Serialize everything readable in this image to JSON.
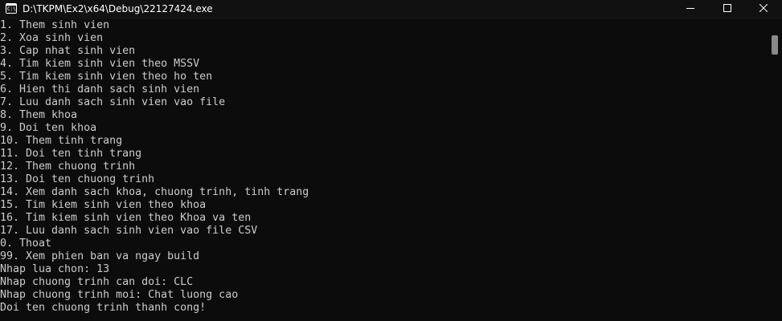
{
  "window": {
    "title": "D:\\TKPM\\Ex2\\x64\\Debug\\22127424.exe",
    "icon": "console-app-icon",
    "icon_text": "C:\\"
  },
  "console": {
    "lines": [
      "1. Them sinh vien",
      "2. Xoa sinh vien",
      "3. Cap nhat sinh vien",
      "4. Tim kiem sinh vien theo MSSV",
      "5. Tim kiem sinh vien theo ho ten",
      "6. Hien thi danh sach sinh vien",
      "7. Luu danh sach sinh vien vao file",
      "8. Them khoa",
      "9. Doi ten khoa",
      "10. Them tinh trang",
      "11. Doi ten tinh trang",
      "12. Them chuong trinh",
      "13. Doi ten chuong trinh",
      "14. Xem danh sach khoa, chuong trinh, tinh trang",
      "15. Tim kiem sinh vien theo khoa",
      "16. Tim kiem sinh vien theo Khoa va ten",
      "17. Luu danh sach sinh vien vao file CSV",
      "0. Thoat",
      "99. Xem phien ban va ngay build",
      "Nhap lua chon: 13",
      "Nhap chuong trinh can doi: CLC",
      "Nhap chuong trinh moi: Chat luong cao",
      "Doi ten chuong trinh thanh cong!"
    ]
  },
  "colors": {
    "background": "#0c0c0c",
    "text": "#cccccc",
    "titlebar": "#111111"
  }
}
